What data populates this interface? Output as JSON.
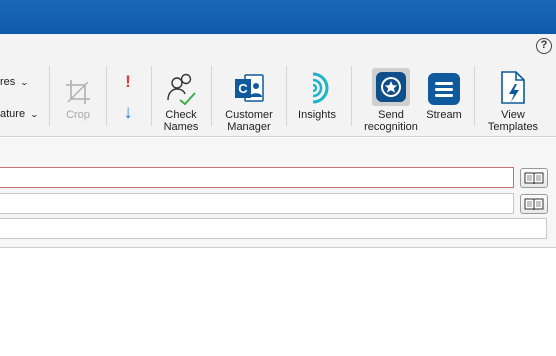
{
  "ribbon": {
    "help_symbol": "?",
    "dropdown_top_label": "res",
    "dropdown_bottom_label": "ature",
    "crop_label": "Crop",
    "importance_high_symbol": "!",
    "importance_low_symbol": "↓",
    "check_names_line1": "Check",
    "check_names_line2": "Names",
    "customer_manager_line1": "Customer",
    "customer_manager_line2": "Manager",
    "insights_label": "Insights",
    "send_recognition_line1": "Send",
    "send_recognition_line2": "recognition",
    "stream_label": "Stream",
    "view_templates_line1": "View",
    "view_templates_line2": "Templates"
  },
  "compose": {
    "to_value": "",
    "cc_value": "",
    "subject_value": ""
  },
  "colors": {
    "titlebar": "#1464b4",
    "accent_blue": "#0e5a9c",
    "importance_red": "#e23b3b",
    "to_border": "#c9707d",
    "insights_teal": "#1fb3c8"
  }
}
